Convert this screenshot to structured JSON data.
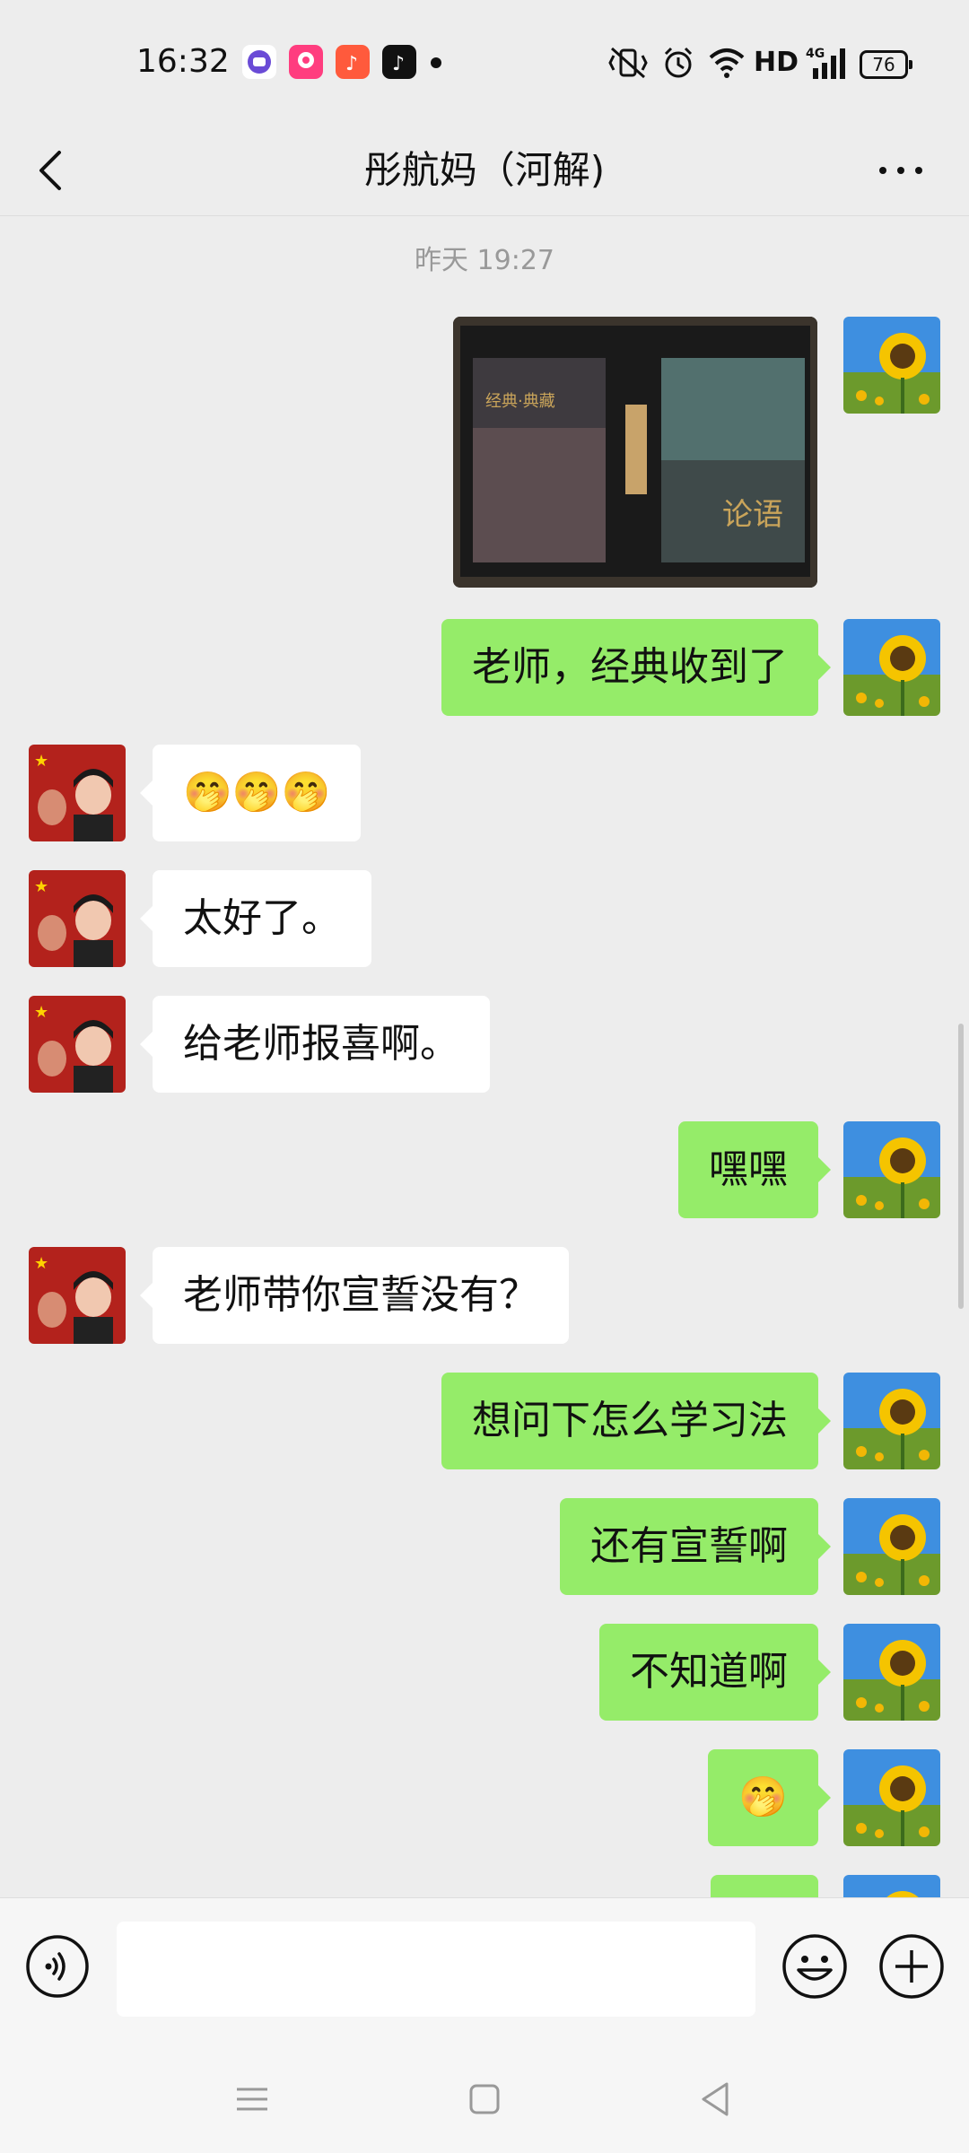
{
  "status_bar": {
    "time": "16:32",
    "network": "HD",
    "signal": "4G",
    "battery": "76"
  },
  "header": {
    "title": "彤航妈（河解)"
  },
  "chat": {
    "timestamp": "昨天 19:27",
    "messages": [
      {
        "side": "out",
        "type": "image",
        "alt": "photo-of-book-gift-box"
      },
      {
        "side": "out",
        "text": "老师，经典收到了"
      },
      {
        "side": "in",
        "text": "🤭🤭🤭"
      },
      {
        "side": "in",
        "text": "太好了。"
      },
      {
        "side": "in",
        "text": "给老师报喜啊。"
      },
      {
        "side": "out",
        "text": "嘿嘿"
      },
      {
        "side": "in",
        "text": "老师带你宣誓没有？"
      },
      {
        "side": "out",
        "text": "想问下怎么学习法"
      },
      {
        "side": "out",
        "text": "还有宣誓啊"
      },
      {
        "side": "out",
        "text": "不知道啊"
      },
      {
        "side": "out",
        "text": "🤭"
      }
    ]
  },
  "input": {
    "value": ""
  },
  "colors": {
    "background": "#ededed",
    "outgoing_bubble": "#95ec69",
    "incoming_bubble": "#ffffff"
  }
}
